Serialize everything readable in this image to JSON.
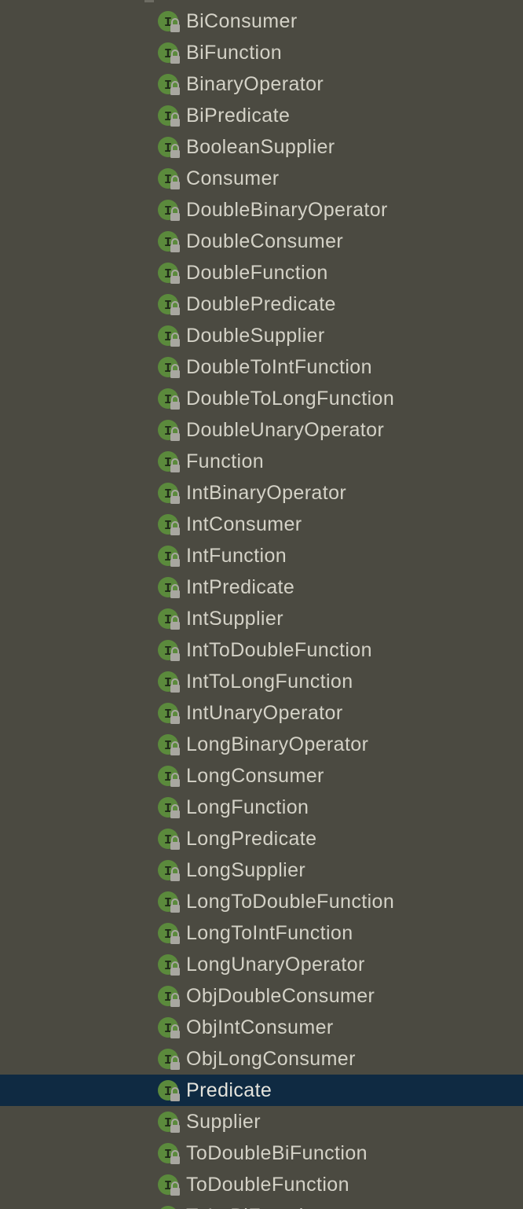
{
  "colors": {
    "background": "#4b4a41",
    "selected_row": "#0f2a42",
    "text": "#d4d2c7",
    "interface_icon_fill": "#5b8a3c",
    "lock_overlay": "#a8a7a0"
  },
  "icon": {
    "name": "interface-icon",
    "letter": "I",
    "overlay": "lock-icon"
  },
  "tree": {
    "selected_index": 34,
    "items": [
      {
        "label": "BiConsumer"
      },
      {
        "label": "BiFunction"
      },
      {
        "label": "BinaryOperator"
      },
      {
        "label": "BiPredicate"
      },
      {
        "label": "BooleanSupplier"
      },
      {
        "label": "Consumer"
      },
      {
        "label": "DoubleBinaryOperator"
      },
      {
        "label": "DoubleConsumer"
      },
      {
        "label": "DoubleFunction"
      },
      {
        "label": "DoublePredicate"
      },
      {
        "label": "DoubleSupplier"
      },
      {
        "label": "DoubleToIntFunction"
      },
      {
        "label": "DoubleToLongFunction"
      },
      {
        "label": "DoubleUnaryOperator"
      },
      {
        "label": "Function"
      },
      {
        "label": "IntBinaryOperator"
      },
      {
        "label": "IntConsumer"
      },
      {
        "label": "IntFunction"
      },
      {
        "label": "IntPredicate"
      },
      {
        "label": "IntSupplier"
      },
      {
        "label": "IntToDoubleFunction"
      },
      {
        "label": "IntToLongFunction"
      },
      {
        "label": "IntUnaryOperator"
      },
      {
        "label": "LongBinaryOperator"
      },
      {
        "label": "LongConsumer"
      },
      {
        "label": "LongFunction"
      },
      {
        "label": "LongPredicate"
      },
      {
        "label": "LongSupplier"
      },
      {
        "label": "LongToDoubleFunction"
      },
      {
        "label": "LongToIntFunction"
      },
      {
        "label": "LongUnaryOperator"
      },
      {
        "label": "ObjDoubleConsumer"
      },
      {
        "label": "ObjIntConsumer"
      },
      {
        "label": "ObjLongConsumer"
      },
      {
        "label": "Predicate"
      },
      {
        "label": "Supplier"
      },
      {
        "label": "ToDoubleBiFunction"
      },
      {
        "label": "ToDoubleFunction"
      },
      {
        "label": "ToIntBiFunction"
      }
    ]
  }
}
